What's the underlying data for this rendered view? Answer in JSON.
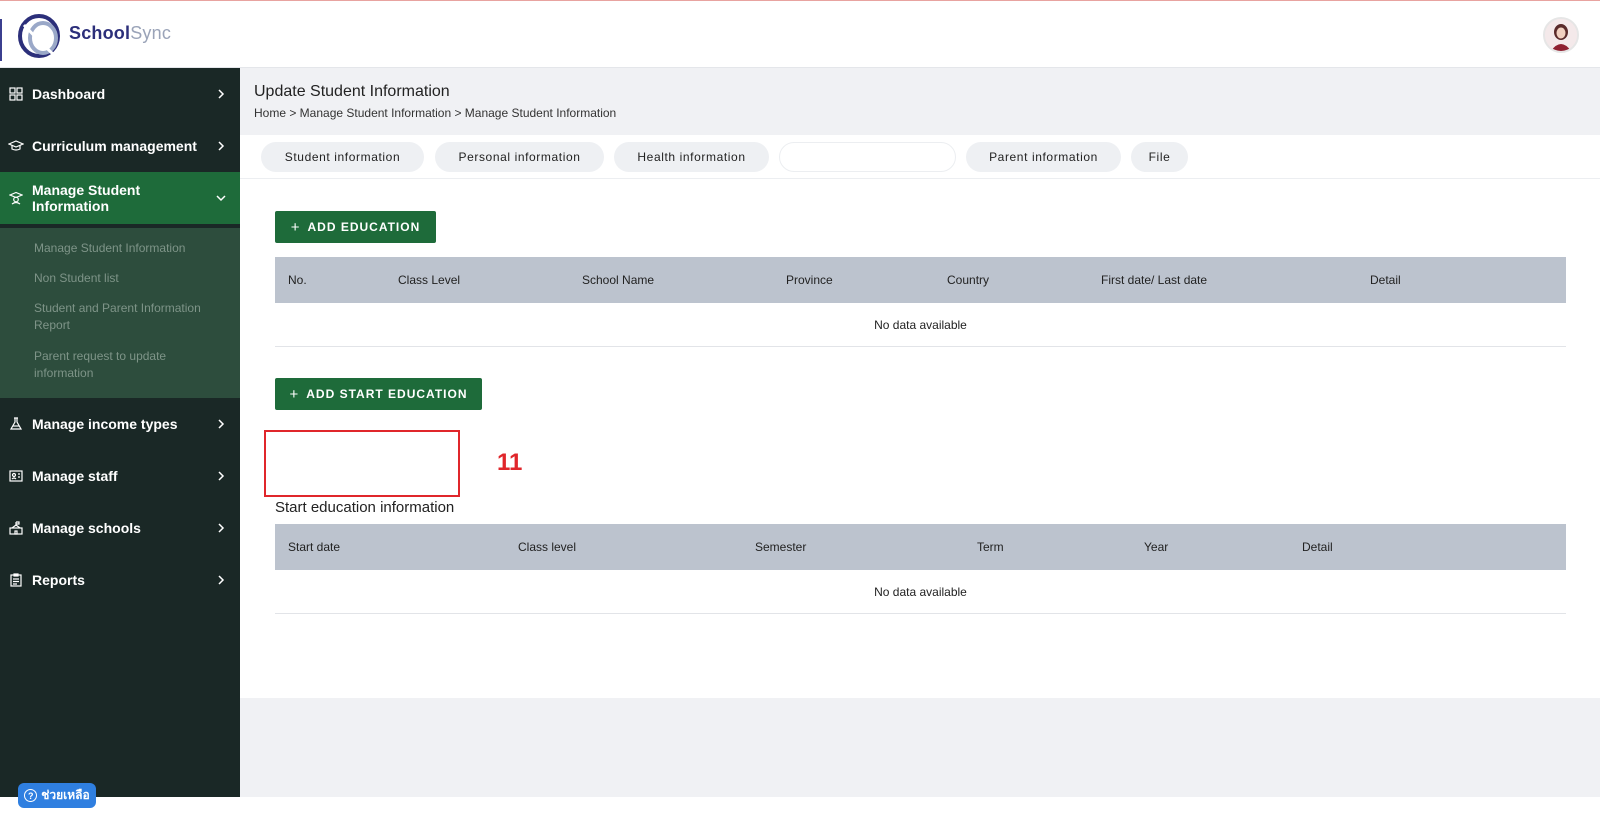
{
  "brand": {
    "name_part1": "School",
    "name_part2": "Sync"
  },
  "colors": {
    "primary_green": "#1e6b3a",
    "sidebar_bg": "#1a2826",
    "submenu_bg": "#2d4d3d",
    "table_header_bg": "#bcc3ce",
    "annotation_red": "#e0262b",
    "help_blue": "#2f7fe0"
  },
  "sidebar": {
    "items": [
      {
        "label": "Dashboard",
        "icon": "grid-icon"
      },
      {
        "label": "Curriculum management",
        "icon": "graduation-cap-icon"
      },
      {
        "label": "Manage Student Information",
        "icon": "student-icon",
        "expanded": true
      },
      {
        "label": "Manage income types",
        "icon": "flask-icon"
      },
      {
        "label": "Manage staff",
        "icon": "id-card-icon"
      },
      {
        "label": "Manage schools",
        "icon": "school-icon"
      },
      {
        "label": "Reports",
        "icon": "clipboard-icon"
      }
    ],
    "submenu": [
      "Manage Student Information",
      "Non Student list",
      "Student and Parent Information Report",
      "Parent request to update information"
    ]
  },
  "header": {
    "title": "Update Student Information",
    "breadcrumb": "Home > Manage Student Information > Manage Student Information"
  },
  "tabs": [
    "Student information",
    "Personal information",
    "Health information",
    "",
    "Parent information",
    "File"
  ],
  "education": {
    "add_button": "ADD EDUCATION",
    "columns": [
      "No.",
      "Class Level",
      "School Name",
      "Province",
      "Country",
      "First date/ Last date",
      "Detail"
    ],
    "empty_text": "No data available"
  },
  "start_education": {
    "add_button": "ADD START EDUCATION",
    "annotation_number": "11",
    "section_title": "Start education information",
    "columns": [
      "Start date",
      "Class level",
      "Semester",
      "Term",
      "Year",
      "Detail"
    ],
    "empty_text": "No data available"
  },
  "help": {
    "label": "ช่วยเหลือ",
    "icon": "help-icon"
  }
}
